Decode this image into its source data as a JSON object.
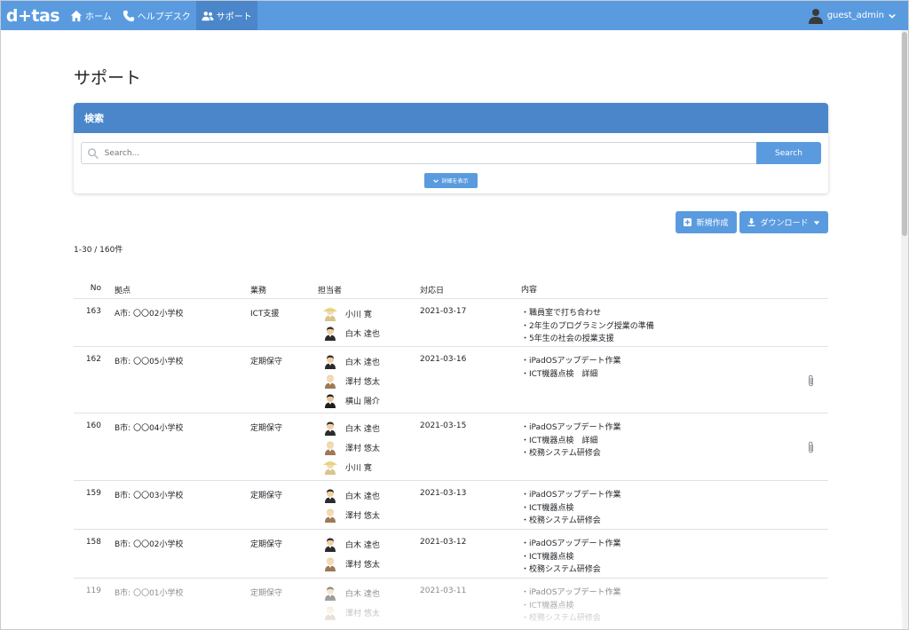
{
  "navbar": {
    "logo": "d+tas",
    "items": [
      {
        "label": "ホーム",
        "icon": "home-icon"
      },
      {
        "label": "ヘルプデスク",
        "icon": "phone-icon"
      },
      {
        "label": "サポート",
        "icon": "users-icon"
      }
    ],
    "user": "guest_admin"
  },
  "page": {
    "title": "サポート"
  },
  "search": {
    "header": "検索",
    "placeholder": "Search...",
    "button": "Search",
    "detail_button": "詳細を表示"
  },
  "actions": {
    "new_label": "新規作成",
    "download_label": "ダウンロード"
  },
  "result_count": "1-30 / 160件",
  "table": {
    "headers": {
      "no": "No",
      "location": "拠点",
      "type": "業務",
      "staff": "担当者",
      "date": "対応日",
      "content": "内容"
    },
    "rows": [
      {
        "no": "163",
        "location": "A市: 〇〇02小学校",
        "type": "ICT支援",
        "staff": [
          "小川 寛",
          "白木 達也"
        ],
        "date": "2021-03-17",
        "content": [
          "・職員室で打ち合わせ",
          "・2年生のプログラミング授業の準備",
          "・5年生の社会の授業支援"
        ],
        "clip": false
      },
      {
        "no": "162",
        "location": "B市: 〇〇05小学校",
        "type": "定期保守",
        "staff": [
          "白木 達也",
          "澤村 悠太",
          "横山 陽介"
        ],
        "date": "2021-03-16",
        "content": [
          "・iPadOSアップデート作業",
          "・ICT機器点検　詳細"
        ],
        "clip": true
      },
      {
        "no": "160",
        "location": "B市: 〇〇04小学校",
        "type": "定期保守",
        "staff": [
          "白木 達也",
          "澤村 悠太",
          "小川 寛"
        ],
        "date": "2021-03-15",
        "content": [
          "・iPadOSアップデート作業",
          "・ICT機器点検　詳細",
          "・校務システム研修会"
        ],
        "clip": true
      },
      {
        "no": "159",
        "location": "B市: 〇〇03小学校",
        "type": "定期保守",
        "staff": [
          "白木 達也",
          "澤村 悠太"
        ],
        "date": "2021-03-13",
        "content": [
          "・iPadOSアップデート作業",
          "・ICT機器点検",
          "・校務システム研修会"
        ],
        "clip": false
      },
      {
        "no": "158",
        "location": "B市: 〇〇02小学校",
        "type": "定期保守",
        "staff": [
          "白木 達也",
          "澤村 悠太"
        ],
        "date": "2021-03-12",
        "content": [
          "・iPadOSアップデート作業",
          "・ICT機器点検",
          "・校務システム研修会"
        ],
        "clip": false
      },
      {
        "no": "119",
        "location": "B市: 〇〇01小学校",
        "type": "定期保守",
        "staff": [
          "白木 達也",
          "澤村 悠太"
        ],
        "date": "2021-03-11",
        "content": [
          "・iPadOSアップデート作業",
          "・ICT機器点検",
          "・校務システム研修会"
        ],
        "clip": false
      }
    ]
  },
  "colors": {
    "navbar": "#5a9be0",
    "card_header": "#4a86c9",
    "button": "#5a9be0"
  }
}
